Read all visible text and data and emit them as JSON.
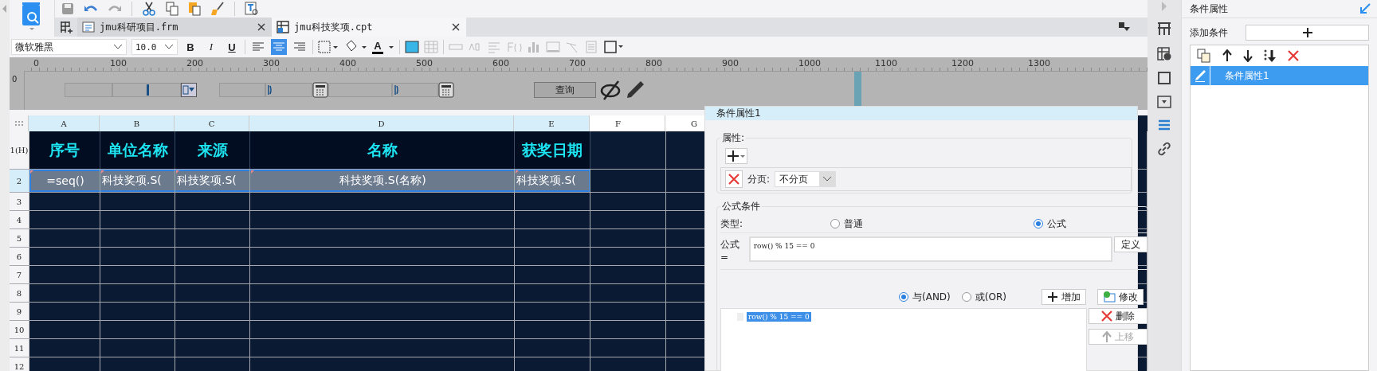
{
  "tabs": [
    {
      "label": "jmu科研项目.frm",
      "selected": false
    },
    {
      "label": "jmu科技奖项.cpt",
      "selected": true
    }
  ],
  "format_bar": {
    "font": "微软雅黑",
    "font_size": "10.0",
    "bold": "B",
    "italic": "I",
    "underline": "U",
    "font_color": "A",
    "align": [
      {
        "selected": false
      },
      {
        "selected": true
      },
      {
        "selected": false
      }
    ]
  },
  "ruler": {
    "vertical": "0",
    "ticks": [
      "0",
      "100",
      "200",
      "300",
      "400",
      "500",
      "600",
      "700",
      "800",
      "900",
      "1000",
      "1100",
      "1200",
      "1300"
    ]
  },
  "widgets": {
    "query_button": "查询"
  },
  "sheet": {
    "columns": [
      "A",
      "B",
      "C",
      "D",
      "E",
      "F",
      "G"
    ],
    "row_labels": [
      "1(H)",
      "2",
      "3",
      "4",
      "5",
      "6",
      "7",
      "8",
      "9",
      "10",
      "11",
      "12"
    ],
    "header_cells": [
      "序号",
      "单位名称",
      "来源",
      "名称",
      "获奖日期"
    ],
    "data_cells": [
      "=seq()",
      "科技奖项.S(",
      "科技奖项.S(",
      "科技奖项.S(名称)",
      "科技奖项.S("
    ]
  },
  "dialog": {
    "title": "条件属性1",
    "properties_label": "属性:",
    "page_break_label": "分页:",
    "page_break_value": "不分页",
    "formula_section": "公式条件",
    "type_label": "类型:",
    "types": [
      {
        "label": "普通",
        "selected": false
      },
      {
        "label": "公式",
        "selected": true
      }
    ],
    "formula_label": "公式=",
    "formula": "row() % 15 == 0",
    "define_button": "定义",
    "logic": [
      {
        "label": "与(AND)",
        "selected": true
      },
      {
        "label": "或(OR)",
        "selected": false
      }
    ],
    "add_button": "增加",
    "modify_button": "修改",
    "conditions": [
      {
        "text": "row() % 15 == 0",
        "selected": true
      }
    ],
    "delete_button": "删除",
    "move_up_button": {
      "label": "上移",
      "disabled": true
    }
  },
  "right_panel": {
    "title": "条件属性",
    "add_label": "添加条件",
    "items": [
      {
        "label": "条件属性1",
        "selected": true
      }
    ]
  }
}
